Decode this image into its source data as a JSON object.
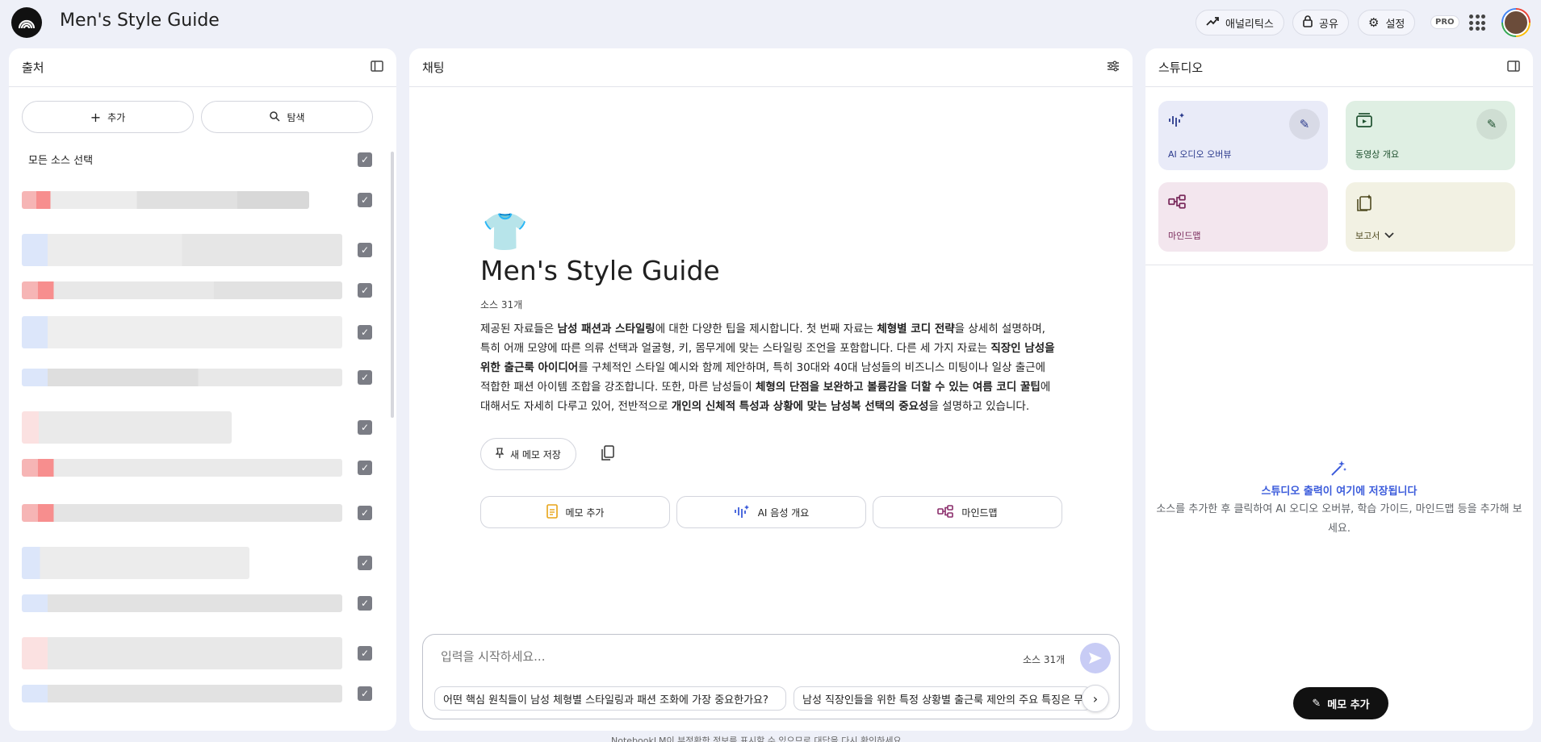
{
  "header": {
    "title": "Men's Style Guide",
    "analytics": "애널리틱스",
    "share": "공유",
    "settings": "설정",
    "pro": "PRO"
  },
  "sources": {
    "title": "출처",
    "add": "추가",
    "explore": "탐색",
    "select_all": "모든 소스 선택"
  },
  "chat": {
    "title": "채팅",
    "notebook_title": "Men's Style Guide",
    "source_count": "소스 31개",
    "summary": {
      "p1": "제공된 자료들은 ",
      "b1": "남성 패션과 스타일링",
      "p2": "에 대한 다양한 팁을 제시합니다. 첫 번째 자료는 ",
      "b2": "체형별 코디 전략",
      "p3": "을 상세히 설명하며, 특히 어깨 모양에 따른 의류 선택과 얼굴형, 키, 몸무게에 맞는 스타일링 조언을 포함합니다. 다른 세 가지 자료는 ",
      "b3": "직장인 남성을 위한 출근룩 아이디어",
      "p4": "를 구체적인 스타일 예시와 함께 제안하며, 특히 30대와 40대 남성들의 비즈니스 미팅이나 일상 출근에 적합한 패션 아이템 조합을 강조합니다. 또한, 마른 남성들이 ",
      "b4": "체형의 단점을 보완하고 볼륨감을 더할 수 있는 여름 코디 꿀팁",
      "p5": "에 대해서도 자세히 다루고 있어, 전반적으로 ",
      "b5": "개인의 신체적 특성과 상황에 맞는 남성복 선택의 중요성",
      "p6": "을 설명하고 있습니다."
    },
    "save_memo": "새 메모 저장",
    "actions": {
      "add_memo": "메모 추가",
      "audio_overview": "AI 음성 개요",
      "mindmap": "마인드맵"
    },
    "input_placeholder": "입력을 시작하세요...",
    "input_count": "소스 31개",
    "suggestions": [
      "어떤 핵심 원칙들이 남성 체형별 스타일링과 패션 조화에 가장 중요한가요?",
      "남성 직장인들을 위한 특정 상황별 출근룩 제안의 주요 특징은 무엇"
    ],
    "footer": "NotebookLM이 부정확한 정보를 표시할 수 있으므로 대답을 다시 확인하세요."
  },
  "studio": {
    "title": "스튜디오",
    "tiles": [
      {
        "label": "AI 오디오 오버뷰",
        "color": "#e9ebf8",
        "text_color": "#2b3a8c"
      },
      {
        "label": "동영상 개요",
        "color": "#dfefe3",
        "text_color": "#1f5130"
      },
      {
        "label": "마인드맵",
        "color": "#f3e6ee",
        "text_color": "#7a2b5c"
      },
      {
        "label": "보고서",
        "color": "#f2f1e3",
        "text_color": "#4f4a20"
      }
    ],
    "empty_title": "스튜디오 출력이 여기에 저장됩니다",
    "empty_desc": "소스를 추가한 후 클릭하여 AI 오디오 오버뷰, 학습 가이드, 마인드맵 등을 추가해 보세요.",
    "add_memo": "메모 추가"
  },
  "colors": {
    "accent": "#3b5bdb",
    "background": "#eef0f8"
  }
}
